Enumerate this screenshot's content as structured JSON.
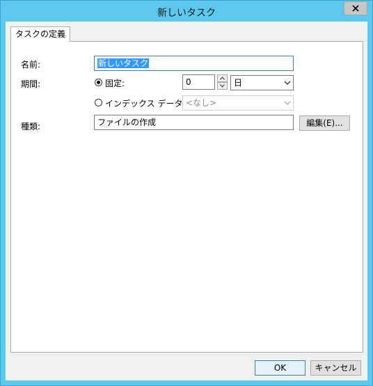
{
  "window": {
    "title": "新しいタスク"
  },
  "tabs": [
    {
      "label": "タスクの定義"
    }
  ],
  "form": {
    "name_label": "名前:",
    "name_value": "新しいタスク",
    "period_label": "期間:",
    "fixed_label": "固定:",
    "fixed_value": "0",
    "unit_value": "日",
    "index_label": "インデックス データ:",
    "index_value": "<なし>",
    "type_label": "種類:",
    "type_value": "ファイルの作成",
    "edit_button": "編集(E)..."
  },
  "footer": {
    "ok": "OK",
    "cancel": "キャンセル"
  }
}
